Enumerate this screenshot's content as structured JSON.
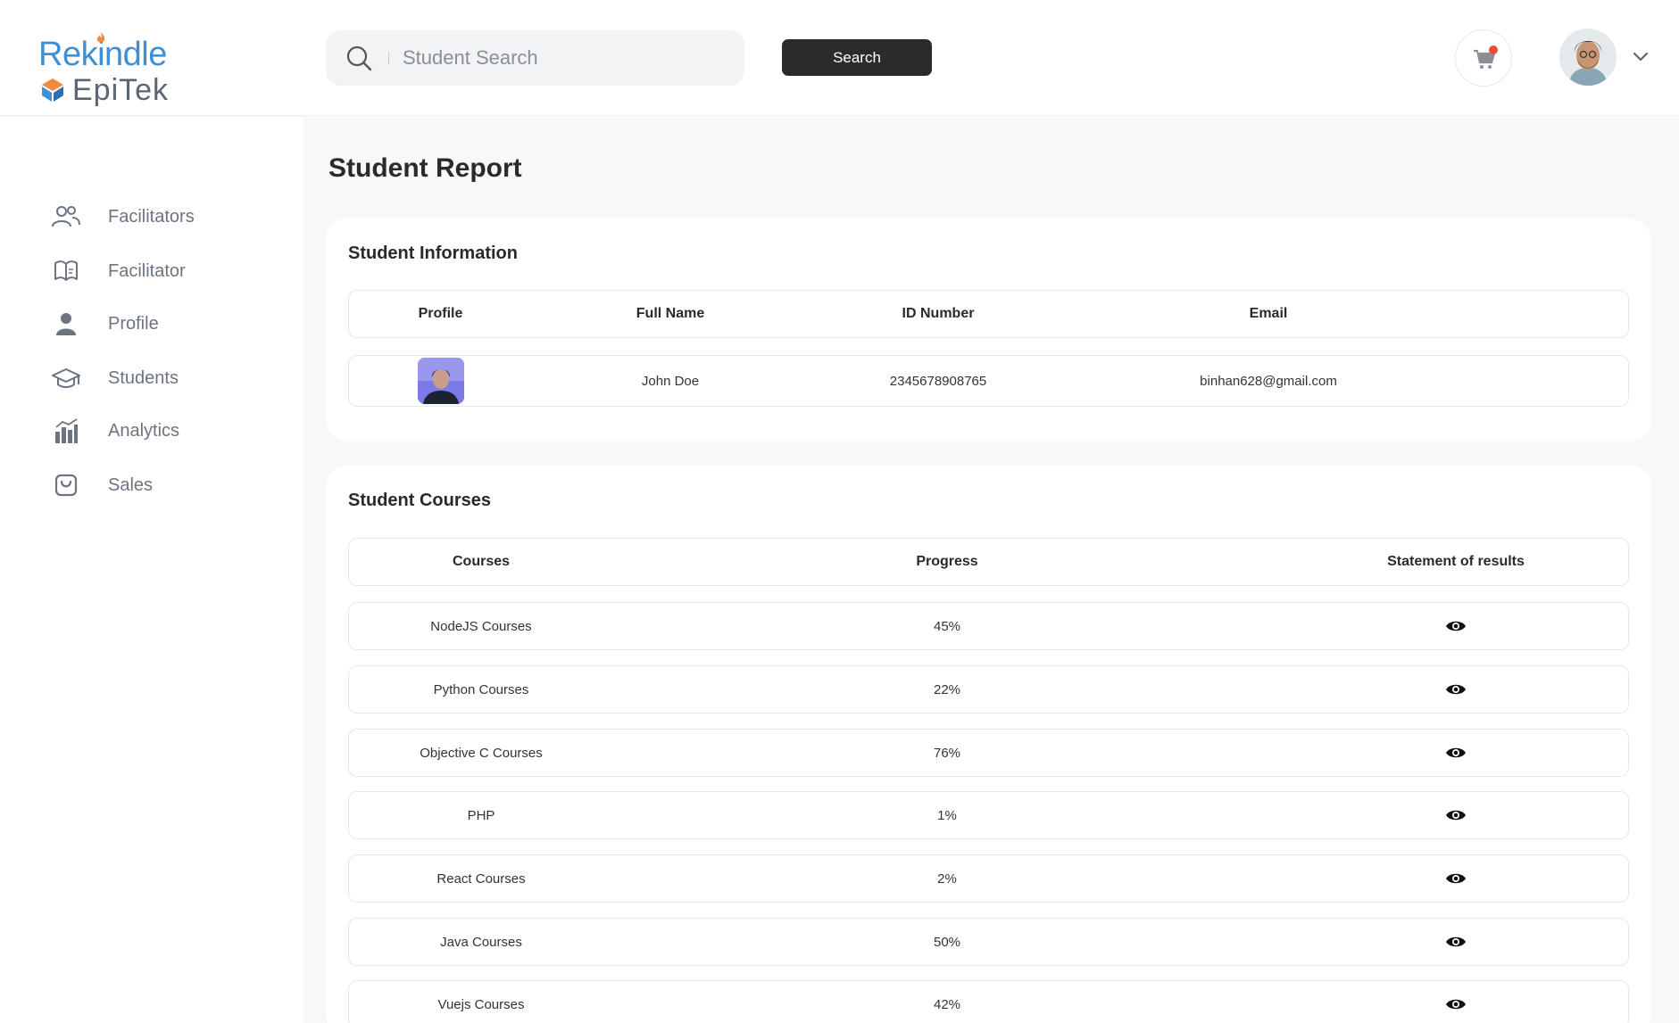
{
  "brand": {
    "line1": "Rekindle",
    "line2": "EpiTek",
    "primary_color": "#3d8fd6",
    "accent_color": "#f08a3e"
  },
  "search": {
    "placeholder": "Student Search",
    "button_label": "Search"
  },
  "header": {
    "cart_icon": "cart-icon",
    "cart_badge_color": "#e74c3c",
    "avatar_icon": "user-avatar",
    "menu_icon": "chevron-down-icon"
  },
  "sidebar": {
    "items": [
      {
        "label": "Facilitators",
        "icon": "users-icon"
      },
      {
        "label": "Facilitator",
        "icon": "book-icon"
      },
      {
        "label": "Profile",
        "icon": "user-icon"
      },
      {
        "label": "Students",
        "icon": "graduation-cap-icon"
      },
      {
        "label": "Analytics",
        "icon": "bar-chart-icon"
      },
      {
        "label": "Sales",
        "icon": "shopping-bag-icon"
      }
    ]
  },
  "page": {
    "title": "Student Report"
  },
  "student_info": {
    "title": "Student Information",
    "columns": [
      "Profile",
      "Full Name",
      "ID Number",
      "Email"
    ],
    "row": {
      "photo": "student-photo",
      "full_name": "John Doe",
      "id_number": "2345678908765",
      "email": "binhan628@gmail.com"
    }
  },
  "student_courses": {
    "title": "Student Courses",
    "columns": [
      "Courses",
      "Progress",
      "Statement of results"
    ],
    "rows": [
      {
        "course": "NodeJS Courses",
        "progress": "45%",
        "action_icon": "eye-icon"
      },
      {
        "course": "Python Courses",
        "progress": "22%",
        "action_icon": "eye-icon"
      },
      {
        "course": "Objective C Courses",
        "progress": "76%",
        "action_icon": "eye-icon"
      },
      {
        "course": "PHP",
        "progress": "1%",
        "action_icon": "eye-icon"
      },
      {
        "course": "React Courses",
        "progress": "2%",
        "action_icon": "eye-icon"
      },
      {
        "course": "Java Courses",
        "progress": "50%",
        "action_icon": "eye-icon"
      },
      {
        "course": "Vuejs Courses",
        "progress": "42%",
        "action_icon": "eye-icon"
      }
    ]
  }
}
